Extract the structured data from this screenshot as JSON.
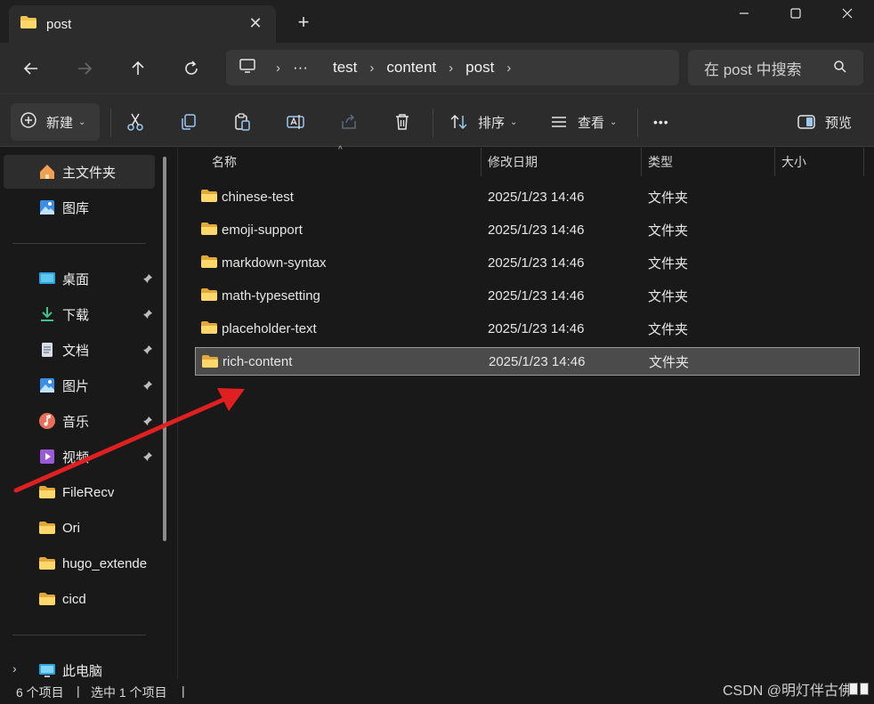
{
  "tab": {
    "title": "post",
    "close": "✕",
    "new": "+"
  },
  "window": {
    "minimize": "—",
    "maximize": "☐",
    "close": "✕"
  },
  "address": {
    "ellipsis": "···",
    "segments": [
      "test",
      "content",
      "post"
    ],
    "search_placeholder": "在 post 中搜索"
  },
  "toolbar": {
    "new_label": "新建",
    "sort_label": "排序",
    "view_label": "查看",
    "more_label": "•••",
    "preview_label": "预览"
  },
  "sidebar": {
    "items": [
      {
        "label": "主文件夹",
        "icon": "home-icon"
      },
      {
        "label": "图库",
        "icon": "gallery-icon"
      },
      {
        "label": "桌面",
        "icon": "desktop-icon",
        "pinned": true
      },
      {
        "label": "下载",
        "icon": "download-icon",
        "pinned": true
      },
      {
        "label": "文档",
        "icon": "document-icon",
        "pinned": true
      },
      {
        "label": "图片",
        "icon": "pictures-icon",
        "pinned": true
      },
      {
        "label": "音乐",
        "icon": "music-icon",
        "pinned": true
      },
      {
        "label": "视频",
        "icon": "video-icon",
        "pinned": true
      },
      {
        "label": "FileRecv",
        "icon": "folder-icon"
      },
      {
        "label": "Ori",
        "icon": "folder-icon"
      },
      {
        "label": "hugo_extende",
        "icon": "folder-icon"
      },
      {
        "label": "cicd",
        "icon": "folder-icon"
      },
      {
        "label": "此电脑",
        "icon": "computer-icon"
      }
    ]
  },
  "columns": {
    "name": "名称",
    "modified": "修改日期",
    "type": "类型",
    "size": "大小"
  },
  "files": [
    {
      "name": "chinese-test",
      "modified": "2025/1/23 14:46",
      "type": "文件夹"
    },
    {
      "name": "emoji-support",
      "modified": "2025/1/23 14:46",
      "type": "文件夹"
    },
    {
      "name": "markdown-syntax",
      "modified": "2025/1/23 14:46",
      "type": "文件夹"
    },
    {
      "name": "math-typesetting",
      "modified": "2025/1/23 14:46",
      "type": "文件夹"
    },
    {
      "name": "placeholder-text",
      "modified": "2025/1/23 14:46",
      "type": "文件夹"
    },
    {
      "name": "rich-content",
      "modified": "2025/1/23 14:46",
      "type": "文件夹",
      "selected": true
    }
  ],
  "status": {
    "count": "6 个项目",
    "selected": "选中 1 个项目"
  },
  "watermark": "CSDN @明灯伴古佛",
  "colors": {
    "folder": "#f2c14e",
    "arrow": "#e02020",
    "selection": "#4b4b4b"
  }
}
